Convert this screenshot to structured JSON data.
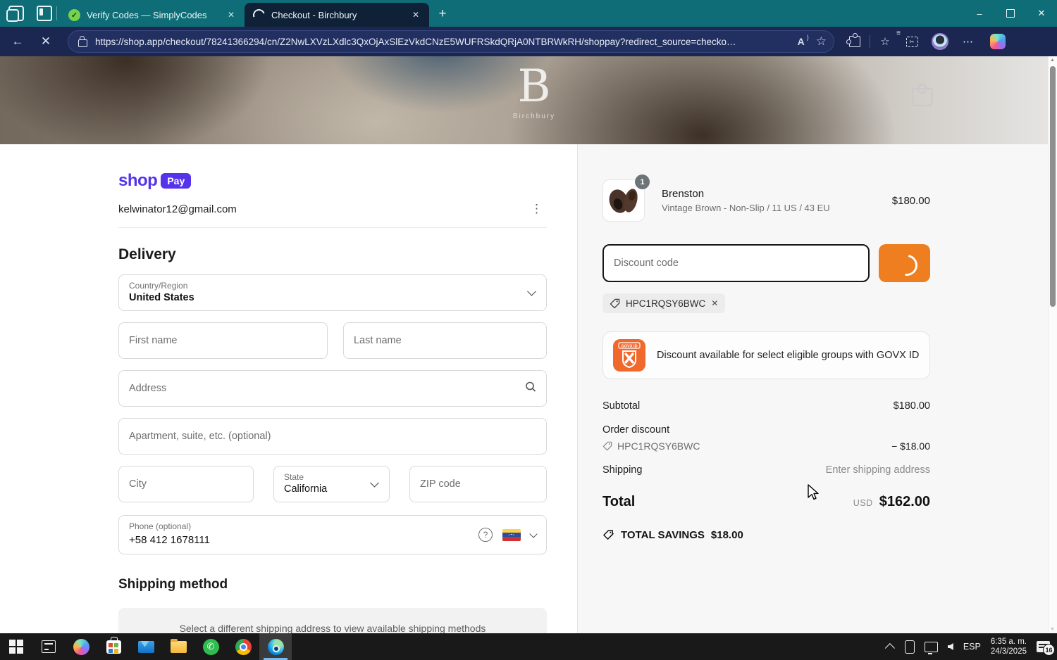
{
  "icons": {
    "close": "✕",
    "plus": "+",
    "minimize": "–",
    "back": "←",
    "stop": "✕",
    "star": "☆",
    "read_aloud": "A",
    "more": "⋯",
    "kebab": "⋮",
    "check": "✓",
    "question": "?",
    "scroll_up": "▲",
    "scroll_down": "▼",
    "phone_glyph": "✆"
  },
  "browser": {
    "tabs": [
      {
        "title": "Verify Codes — SimplyCodes"
      },
      {
        "title": "Checkout - Birchbury"
      }
    ],
    "url": "https://shop.app/checkout/78241366294/cn/Z2NwLXVzLXdlc3QxOjAxSlEzVkdCNzE5WUFRSkdQRjA0NTBRWkRH/shoppay?redirect_source=checko…"
  },
  "page": {
    "brand": {
      "logo_letter": "B",
      "logo_name": "Birchbury"
    },
    "express": {
      "shop_label": "shop",
      "pay_label": "Pay",
      "email": "kelwinator12@gmail.com"
    },
    "delivery": {
      "title": "Delivery",
      "country_label": "Country/Region",
      "country_value": "United States",
      "first_name_placeholder": "First name",
      "last_name_placeholder": "Last name",
      "address_placeholder": "Address",
      "apartment_placeholder": "Apartment, suite, etc. (optional)",
      "city_placeholder": "City",
      "state_label": "State",
      "state_value": "California",
      "zip_placeholder": "ZIP code",
      "phone_label": "Phone (optional)",
      "phone_value": "+58 412 1678111"
    },
    "shipping_method": {
      "title": "Shipping method",
      "notice": "Select a different shipping address to view available shipping methods"
    },
    "summary": {
      "item": {
        "qty": "1",
        "name": "Brenston",
        "variant": "Vintage Brown - Non-Slip / 11 US / 43 EU",
        "price": "$180.00"
      },
      "discount_placeholder": "Discount code",
      "applied_code": "HPC1RQSY6BWC",
      "govx_logo_text": "GOVX ID",
      "govx_text": "Discount available for select eligible groups with GOVX ID",
      "subtotal_label": "Subtotal",
      "subtotal_value": "$180.00",
      "discount_label": "Order discount",
      "discount_code": "HPC1RQSY6BWC",
      "discount_value": "− $18.00",
      "shipping_label": "Shipping",
      "shipping_value": "Enter shipping address",
      "total_label": "Total",
      "currency": "USD",
      "total_value": "$162.00",
      "savings_label": "TOTAL SAVINGS",
      "savings_value": "$18.00"
    }
  },
  "taskbar": {
    "language": "ESP",
    "time": "6:35 a. m.",
    "date": "24/3/2025",
    "notification_count": "16"
  }
}
